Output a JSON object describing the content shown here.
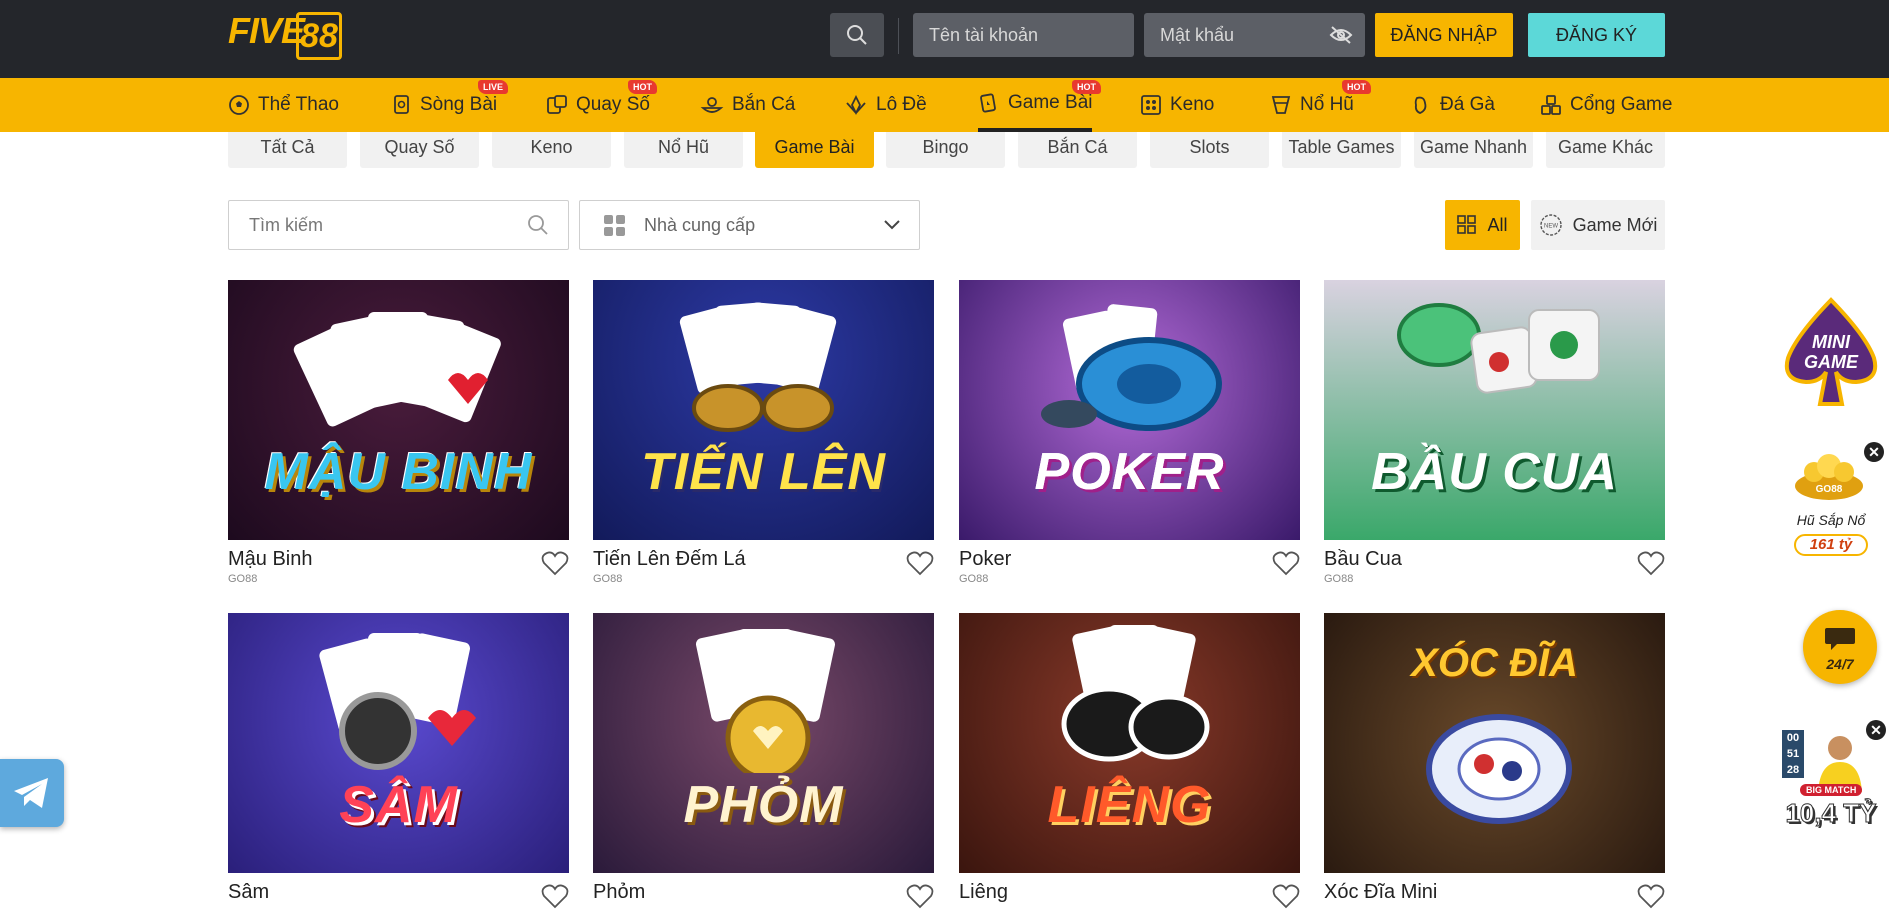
{
  "header": {
    "logo_text": "FIVE",
    "logo_number": "88",
    "username_placeholder": "Tên tài khoản",
    "password_placeholder": "Mật khẩu",
    "login_label": "ĐĂNG NHẬP",
    "register_label": "ĐĂNG KÝ",
    "brand_color": "#f7b500"
  },
  "nav": {
    "items": [
      {
        "label": "Thể Thao",
        "badge": ""
      },
      {
        "label": "Sòng Bài",
        "badge": "LIVE"
      },
      {
        "label": "Quay Số",
        "badge": "HOT"
      },
      {
        "label": "Bắn Cá",
        "badge": ""
      },
      {
        "label": "Lô Đề",
        "badge": ""
      },
      {
        "label": "Game Bài",
        "badge": "HOT"
      },
      {
        "label": "Keno",
        "badge": ""
      },
      {
        "label": "Nổ Hũ",
        "badge": "HOT"
      },
      {
        "label": "Đá Gà",
        "badge": ""
      },
      {
        "label": "Cổng Game",
        "badge": ""
      }
    ],
    "active": "Game Bài"
  },
  "subtabs": [
    "Tất Cả",
    "Quay Số",
    "Keno",
    "Nổ Hũ",
    "Game Bài",
    "Bingo",
    "Bắn Cá",
    "Slots",
    "Table Games",
    "Game Nhanh",
    "Game Khác"
  ],
  "subtab_active": "Game Bài",
  "filters": {
    "search_placeholder": "Tìm kiếm",
    "provider_placeholder": "Nhà cung cấp",
    "all_label": "All",
    "new_label": "Game Mới",
    "new_icon_text": "NEW"
  },
  "games": [
    {
      "name": "Mậu Binh",
      "provider": "GO88",
      "art": "MẬU BINH"
    },
    {
      "name": "Tiến Lên Đếm Lá",
      "provider": "GO88",
      "art": "TIẾN LÊN"
    },
    {
      "name": "Poker",
      "provider": "GO88",
      "art": "POKER"
    },
    {
      "name": "Bầu Cua",
      "provider": "GO88",
      "art": "BẦU CUA"
    },
    {
      "name": "Sâm",
      "provider": "",
      "art": "SÂM"
    },
    {
      "name": "Phỏm",
      "provider": "",
      "art": "PHỎM"
    },
    {
      "name": "Liêng",
      "provider": "",
      "art": "LIÊNG"
    },
    {
      "name": "Xóc Đĩa Mini",
      "provider": "",
      "art": "XÓC ĐĨA"
    }
  ],
  "floating": {
    "mini_game_1": "MINI",
    "mini_game_2": "GAME",
    "jackpot_brand": "GO88",
    "jackpot_label": "Hũ Sắp Nổ",
    "jackpot_value": "161 tỷ",
    "support_label": "24/7",
    "match_badge": "BIG MATCH",
    "match_countdown": [
      "00",
      "51",
      "28"
    ],
    "match_value": "10,4 TỶ"
  }
}
